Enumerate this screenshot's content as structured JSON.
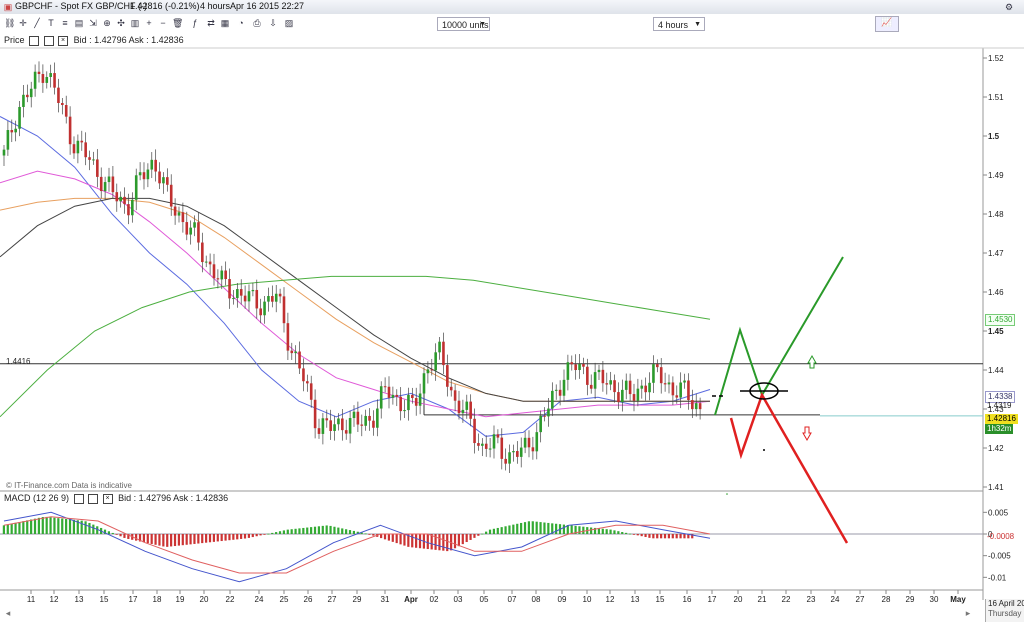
{
  "window": {
    "title": "GBPCHF - Spot FX GBP/CHF (-)",
    "price": "1.42816 (-0.21%)",
    "interval": "4 hours",
    "timestamp": "Apr 16 2015 22:27"
  },
  "toolbar": {
    "units_select": "10000 units",
    "period_select": "4 hours"
  },
  "price_panel": {
    "label": "Price",
    "bid_ask": "Bid : 1.42796 Ask : 1.42836",
    "footer": "© IT-Finance.com  Data is indicative",
    "level_label": "1.4416"
  },
  "price_tags": {
    "t1": "1.4530",
    "t2": "1.4338",
    "t3": "1.4319",
    "t4": "1.42816",
    "t5": "1h32m"
  },
  "macd_panel": {
    "label": "MACD (12 26 9)",
    "bid_ask": "Bid : 1.42796 Ask : 1.42836",
    "tag": "-0.0008"
  },
  "date_box": {
    "date": "16 April 2015",
    "day": "Thursday"
  },
  "chart_data": [
    {
      "type": "line",
      "subtype": "candlestick",
      "title": "GBPCHF - Spot FX GBP/CHF (-)",
      "ylim": [
        1.405,
        1.525
      ],
      "y_ticks": [
        "1.52",
        "1.51",
        "1.5",
        "1.49",
        "1.48",
        "1.47",
        "1.46",
        "1.45",
        "1.44",
        "1.43",
        "1.42",
        "1.41"
      ],
      "x_ticks": [
        "11",
        "12",
        "13",
        "15",
        "17",
        "18",
        "19",
        "20",
        "22",
        "24",
        "25",
        "26",
        "27",
        "29",
        "31",
        "Apr",
        "02",
        "03",
        "05",
        "07",
        "08",
        "09",
        "10",
        "12",
        "13",
        "15",
        "16",
        "17",
        "20",
        "21",
        "22",
        "23",
        "24",
        "27",
        "28",
        "29",
        "30",
        "May"
      ],
      "candles_sampled": [
        1.495,
        1.507,
        1.512,
        1.518,
        1.509,
        1.499,
        1.495,
        1.49,
        1.485,
        1.482,
        1.489,
        1.494,
        1.484,
        1.479,
        1.474,
        1.467,
        1.462,
        1.46,
        1.458,
        1.457,
        1.459,
        1.446,
        1.437,
        1.426,
        1.425,
        1.427,
        1.426,
        1.428,
        1.435,
        1.432,
        1.43,
        1.441,
        1.444,
        1.432,
        1.428,
        1.42,
        1.421,
        1.418,
        1.419,
        1.424,
        1.431,
        1.439,
        1.441,
        1.438,
        1.437,
        1.435,
        1.433,
        1.437,
        1.439,
        1.435,
        1.434,
        1.43
      ],
      "series": [
        {
          "name": "",
          "color": "#5b6be0",
          "values": [
            1.505,
            1.5,
            1.492,
            1.48,
            1.47,
            1.462,
            1.452,
            1.44,
            1.432,
            1.428,
            1.432,
            1.434,
            1.43,
            1.423,
            1.424,
            1.432,
            1.433,
            1.431,
            1.432,
            1.435
          ]
        },
        {
          "name": "",
          "color": "#e05ad8",
          "values": [
            1.488,
            1.491,
            1.489,
            1.485,
            1.478,
            1.47,
            1.461,
            1.452,
            1.444,
            1.438,
            1.435,
            1.432,
            1.43,
            1.428,
            1.429,
            1.43,
            1.431,
            1.431,
            1.431,
            1.432
          ]
        },
        {
          "name": "",
          "color": "#e8a060",
          "values": [
            1.481,
            1.483,
            1.484,
            1.484,
            1.483,
            1.48,
            1.474,
            1.467,
            1.46,
            1.453,
            1.447,
            1.442,
            1.437,
            1.434,
            1.432,
            1.432,
            1.432,
            1.432,
            1.432,
            1.432
          ]
        },
        {
          "name": "",
          "color": "#444444",
          "values": [
            1.469,
            1.477,
            1.482,
            1.484,
            1.484,
            1.482,
            1.477,
            1.47,
            1.463,
            1.456,
            1.449,
            1.443,
            1.438,
            1.434,
            1.432,
            1.432,
            1.432,
            1.432,
            1.432,
            1.432
          ]
        },
        {
          "name": "",
          "color": "#4caf40",
          "values": [
            1.428,
            1.44,
            1.45,
            1.456,
            1.46,
            1.462,
            1.463,
            1.464,
            1.464,
            1.464,
            1.463,
            1.461,
            1.459,
            1.457,
            1.455,
            1.453
          ]
        }
      ],
      "annotations": [
        {
          "text": "horizontal level",
          "value": 1.4416
        },
        {
          "text": "support line",
          "value": 1.4285
        },
        {
          "text": "bullish scenario",
          "color": "#2a9a2a"
        },
        {
          "text": "bearish scenario",
          "color": "#e02020"
        }
      ],
      "grid": false
    },
    {
      "type": "bar",
      "title": "MACD (12 26 9)",
      "ylim": [
        -0.012,
        0.006
      ],
      "y_ticks": [
        "0.005",
        "0",
        "-0.005",
        "-0.01"
      ],
      "values_sampled": [
        0.002,
        0.004,
        0.003,
        -0.001,
        -0.003,
        -0.002,
        -0.001,
        0.001,
        0.002,
        0.0,
        -0.003,
        -0.004,
        0.001,
        0.003,
        0.002,
        0.001,
        -0.001,
        -0.001
      ],
      "series": [
        {
          "name": "",
          "color": "#4455cc",
          "values": [
            0.003,
            0.005,
            0.001,
            -0.004,
            -0.008,
            -0.011,
            -0.008,
            -0.002,
            0.002,
            -0.002,
            -0.005,
            -0.003,
            0.002,
            0.003,
            0.001,
            -0.001
          ]
        },
        {
          "name": "",
          "color": "#e06060",
          "values": [
            0.002,
            0.004,
            0.003,
            -0.002,
            -0.006,
            -0.009,
            -0.009,
            -0.004,
            0.0,
            0.0,
            -0.004,
            -0.004,
            0.0,
            0.002,
            0.002,
            0.0
          ]
        }
      ]
    }
  ]
}
